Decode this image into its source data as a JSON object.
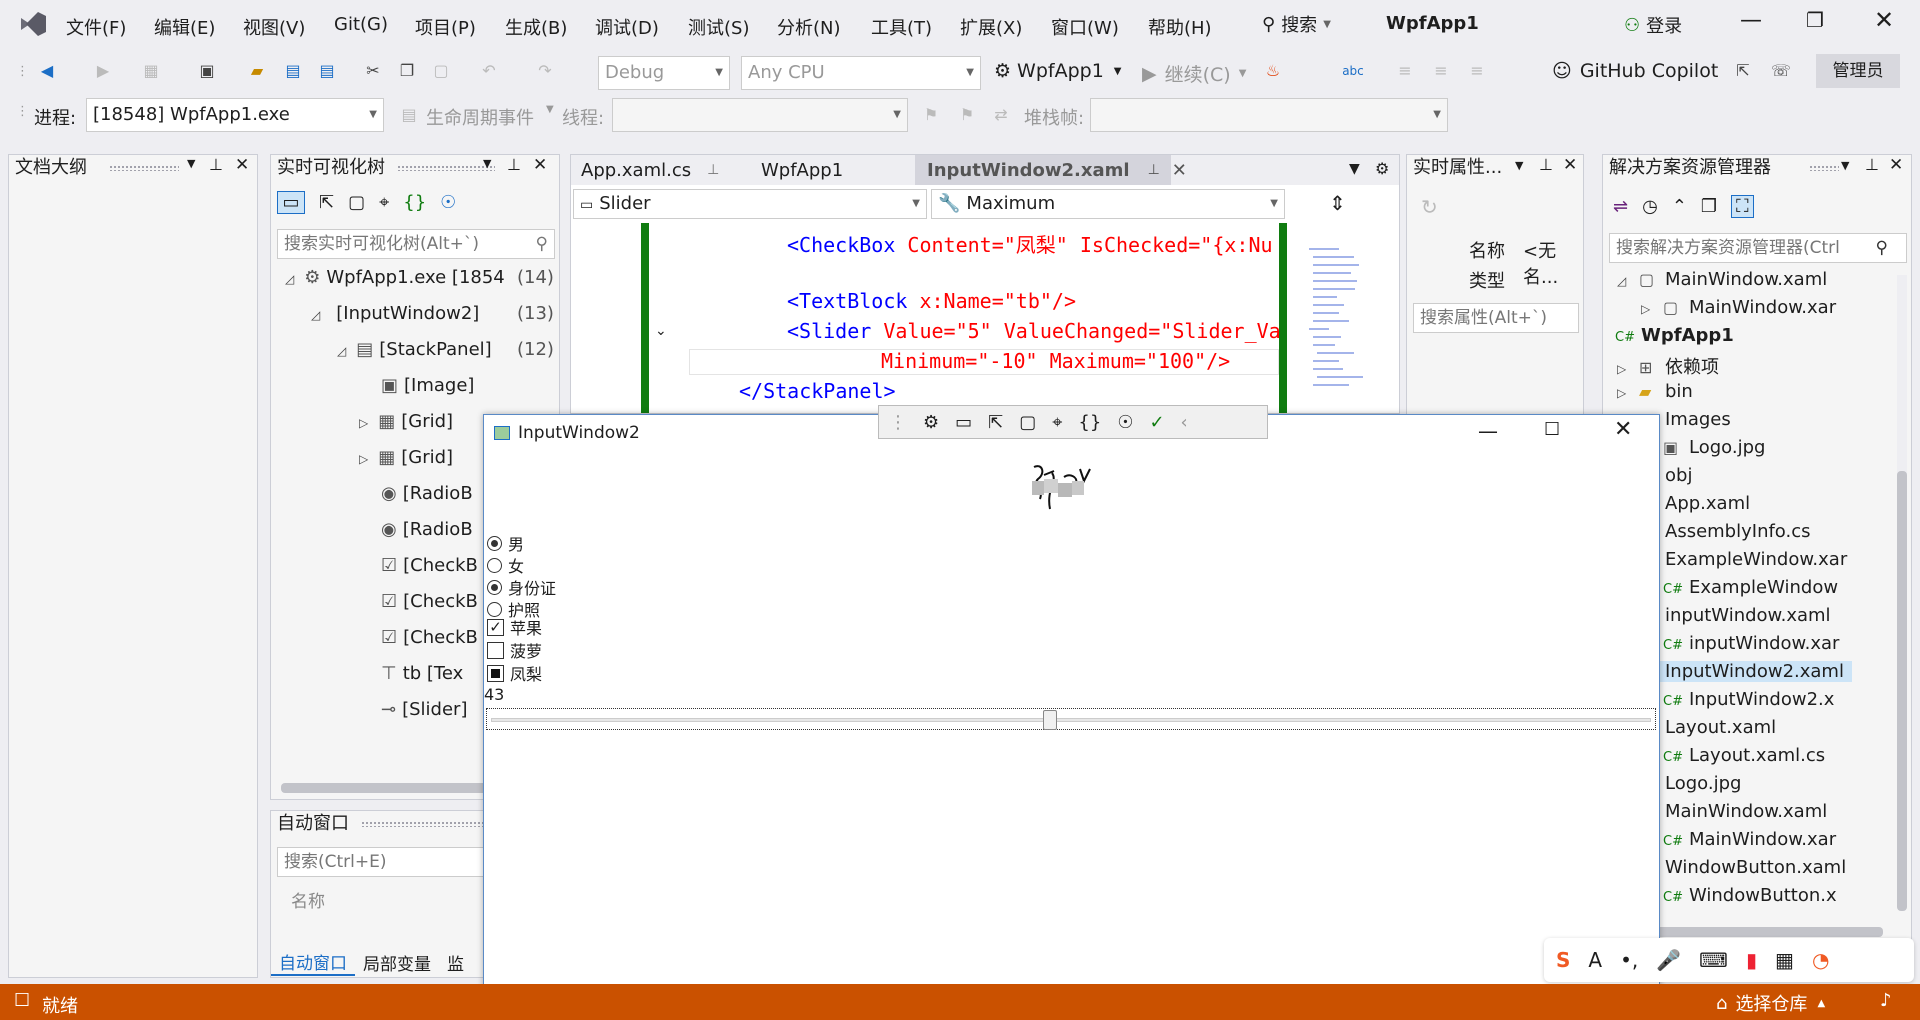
{
  "menu": {
    "file": "文件(F)",
    "edit": "编辑(E)",
    "view": "视图(V)",
    "git": "Git(G)",
    "project": "项目(P)",
    "build": "生成(B)",
    "debug": "调试(D)",
    "test": "测试(S)",
    "analyze": "分析(N)",
    "tools": "工具(T)",
    "extensions": "扩展(X)",
    "window": "窗口(W)",
    "help": "帮助(H)",
    "search": "搜索",
    "app_title": "WpfApp1",
    "login": "登录"
  },
  "toolbar": {
    "config": "Debug",
    "platform": "Any CPU",
    "startup": "WpfApp1",
    "continue": "继续(C)",
    "copilot": "GitHub Copilot",
    "admin": "管理员"
  },
  "toolbar2": {
    "process_label": "进程:",
    "process_value": "[18548] WpfApp1.exe",
    "lifecycle": "生命周期事件",
    "thread": "线程:",
    "stackframe": "堆栈帧:"
  },
  "outline": {
    "title": "文档大纲"
  },
  "visual_tree": {
    "title": "实时可视化树",
    "search_placeholder": "搜索实时可视化树(Alt+`)",
    "nodes": [
      {
        "label": "WpfApp1.exe [1854",
        "count": "(14)"
      },
      {
        "label": "[InputWindow2]",
        "count": "(13)"
      },
      {
        "label": "[StackPanel]",
        "count": "(12)"
      },
      {
        "label": "[Image]",
        "count": ""
      },
      {
        "label": "[Grid]",
        "count": ""
      },
      {
        "label": "[Grid]",
        "count": ""
      },
      {
        "label": "[RadioB",
        "count": ""
      },
      {
        "label": "[RadioB",
        "count": ""
      },
      {
        "label": "[CheckB",
        "count": ""
      },
      {
        "label": "[CheckB",
        "count": ""
      },
      {
        "label": "[CheckB",
        "count": ""
      },
      {
        "label": "tb [Tex",
        "count": ""
      },
      {
        "label": "[Slider]",
        "count": ""
      }
    ]
  },
  "auto_window": {
    "title": "自动窗口",
    "search_placeholder": "搜索(Ctrl+E)",
    "column_name": "名称",
    "tabs": [
      "自动窗口",
      "局部变量",
      "监"
    ]
  },
  "editor": {
    "tabs": [
      "App.xaml.cs",
      "WpfApp1",
      "InputWindow2.xaml"
    ],
    "nav_left": "Slider",
    "nav_right": "Maximum",
    "lines": [
      {
        "tag": "<CheckBox",
        "attrs": " Content=\"凤梨\" IsChecked=\"{x:Nu"
      },
      {
        "tag": "<TextBlock",
        "attrs": " x:Name=\"tb\"/>"
      },
      {
        "tag": "<Slider",
        "attrs": " Value=\"5\" ValueChanged=\"Slider_Va"
      },
      {
        "tag": "",
        "attrs": "Minimum=\"-10\" Maximum=\"100\"/>"
      },
      {
        "tag": "</StackPanel>",
        "attrs": ""
      }
    ]
  },
  "properties": {
    "title": "实时属性...",
    "name_label": "名称",
    "name_value": "<无名...",
    "type_label": "类型",
    "search_placeholder": "搜索属性(Alt+`)"
  },
  "solution": {
    "title": "解决方案资源管理器",
    "search_placeholder": "搜索解决方案资源管理器(Ctrl",
    "items": [
      {
        "label": "MainWindow.xaml"
      },
      {
        "label": "MainWindow.xar"
      },
      {
        "label": "WpfApp1"
      },
      {
        "label": "依赖项"
      },
      {
        "label": "bin"
      },
      {
        "label": "Images"
      },
      {
        "label": "Logo.jpg"
      },
      {
        "label": "obj"
      },
      {
        "label": "App.xaml"
      },
      {
        "label": "AssemblyInfo.cs"
      },
      {
        "label": "ExampleWindow.xar"
      },
      {
        "label": "ExampleWindow"
      },
      {
        "label": "inputWindow.xaml"
      },
      {
        "label": "inputWindow.xar"
      },
      {
        "label": "InputWindow2.xaml"
      },
      {
        "label": "InputWindow2.x"
      },
      {
        "label": "Layout.xaml"
      },
      {
        "label": "Layout.xaml.cs"
      },
      {
        "label": "Logo.jpg"
      },
      {
        "label": "MainWindow.xaml"
      },
      {
        "label": "MainWindow.xar"
      },
      {
        "label": "WindowButton.xaml"
      },
      {
        "label": "WindowButton.x"
      }
    ]
  },
  "app_window": {
    "title": "InputWindow2",
    "radios": [
      {
        "label": "男",
        "checked": true
      },
      {
        "label": "女",
        "checked": false
      },
      {
        "label": "身份证",
        "checked": true
      },
      {
        "label": "护照",
        "checked": false
      }
    ],
    "checks": [
      {
        "label": "苹果",
        "state": "checked"
      },
      {
        "label": "菠萝",
        "state": "unchecked"
      },
      {
        "label": "凤梨",
        "state": "indeterminate"
      }
    ],
    "text": "43",
    "slider": {
      "min": -10,
      "max": 100,
      "value": 43
    }
  },
  "status": {
    "ready": "就绪",
    "repo": "选择仓库"
  },
  "colors": {
    "accent": "#ca5100",
    "vs_purple": "#68217a",
    "green_margin": "#107c10"
  }
}
